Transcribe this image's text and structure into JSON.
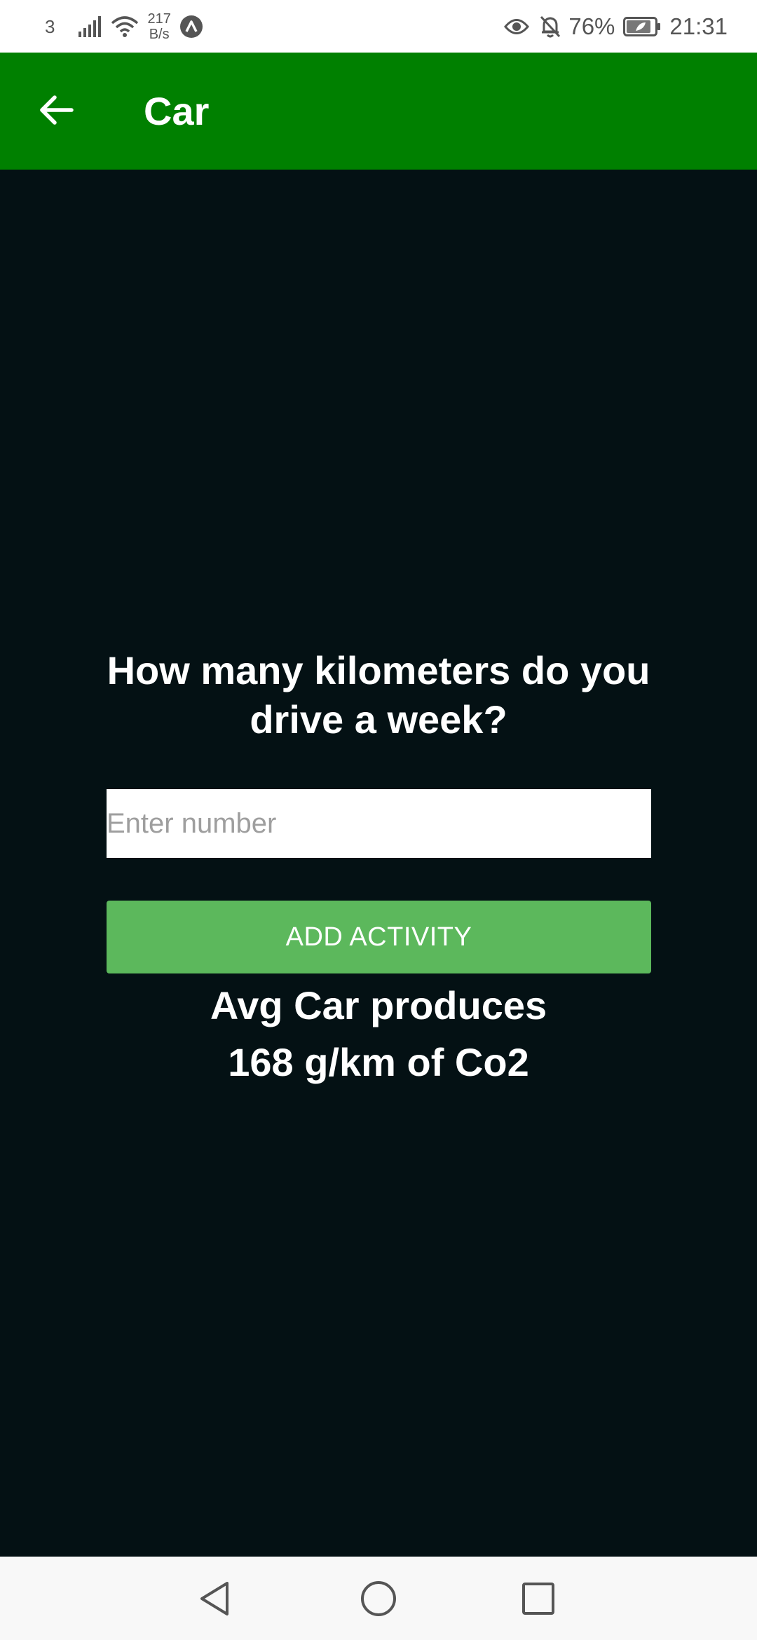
{
  "status_bar": {
    "sim_number": "3",
    "net_speed_value": "217",
    "net_speed_unit": "B/s",
    "battery_percent": "76%",
    "time": "21:31",
    "icons": [
      "signal-icon",
      "wifi-icon",
      "app-notification-icon",
      "eye-icon",
      "bell-off-icon",
      "battery-icon"
    ]
  },
  "app_bar": {
    "title": "Car",
    "background_color": "#008000"
  },
  "main": {
    "question": "How many kilometers do you drive a week?",
    "input_placeholder": "Enter number",
    "input_value": "",
    "button_label": "ADD ACTIVITY",
    "button_color": "#5cb85c",
    "info_line_1": "Avg Car produces",
    "info_line_2": "168 g/km of Co2",
    "background_color": "#041114"
  },
  "nav_bar": {
    "icons": [
      "nav-back-icon",
      "nav-home-icon",
      "nav-recents-icon"
    ]
  }
}
